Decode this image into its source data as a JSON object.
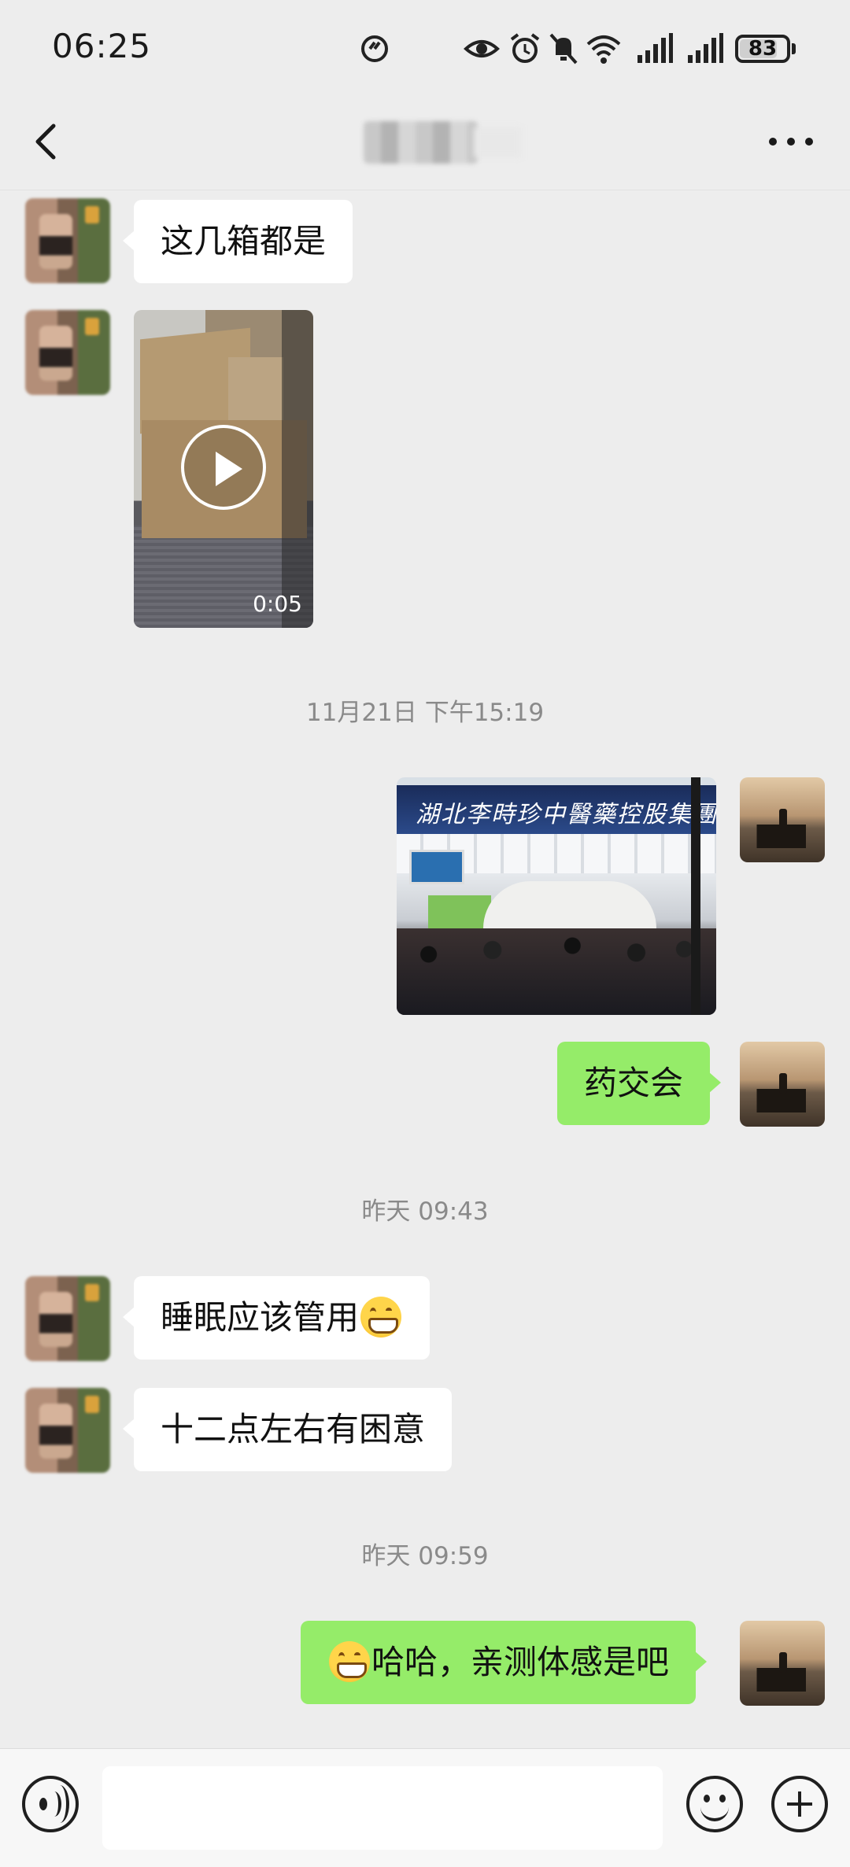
{
  "status_bar": {
    "time": "06:25",
    "battery": "83",
    "battery_level": 0.83,
    "icons": [
      "speed-icon",
      "eye-icon",
      "alarm-icon",
      "mute-icon",
      "wifi-icon",
      "signal-icon",
      "signal-icon"
    ]
  },
  "header": {
    "title": "",
    "back_icon": "chevron-left-icon",
    "more_icon": "more-dots-icon"
  },
  "messages": [
    {
      "sender": "other",
      "type": "text",
      "text": "这几箱都是"
    },
    {
      "sender": "other",
      "type": "video",
      "duration": "0:05"
    },
    {
      "type": "timestamp",
      "text": "11月21日 下午15:19"
    },
    {
      "sender": "self",
      "type": "image",
      "banner_text": "湖北李時珍中醫藥控股集團"
    },
    {
      "sender": "self",
      "type": "text",
      "text": "药交会"
    },
    {
      "type": "timestamp",
      "text": "昨天 09:43"
    },
    {
      "sender": "other",
      "type": "text",
      "text": "睡眠应该管用",
      "emoji_suffix": "grinning-face-icon"
    },
    {
      "sender": "other",
      "type": "text",
      "text": "十二点左右有困意"
    },
    {
      "type": "timestamp",
      "text": "昨天 09:59"
    },
    {
      "sender": "self",
      "type": "text",
      "text": "哈哈，亲测体感是吧",
      "emoji_prefix": "grinning-face-icon"
    }
  ],
  "input_bar": {
    "value": "",
    "placeholder": "",
    "voice_icon": "voice-icon",
    "emoji_icon": "emoji-icon",
    "plus_icon": "plus-icon"
  },
  "colors": {
    "background": "#ededed",
    "self_bubble": "#95ec69",
    "other_bubble": "#ffffff",
    "timestamp_text": "#8a8a8a"
  }
}
